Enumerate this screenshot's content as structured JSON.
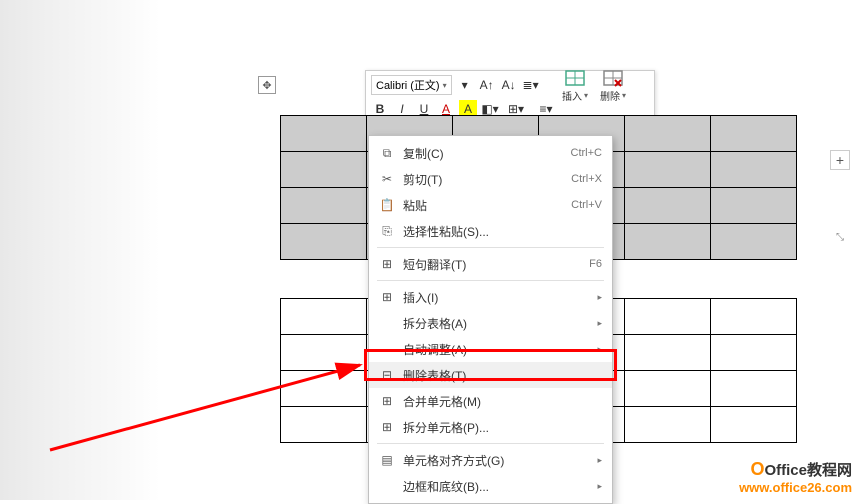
{
  "toolbar": {
    "font_name": "Calibri (正文)",
    "insert_label": "插入",
    "delete_label": "删除",
    "bold": "B",
    "italic": "I",
    "underline": "U",
    "font_color": "A",
    "highlight": "A"
  },
  "move_handle": "✥",
  "context_menu": {
    "items": [
      {
        "icon": "⧉",
        "label": "复制(C)",
        "shortcut": "Ctrl+C"
      },
      {
        "icon": "✂",
        "label": "剪切(T)",
        "shortcut": "Ctrl+X"
      },
      {
        "icon": "📋",
        "label": "粘贴",
        "shortcut": "Ctrl+V"
      },
      {
        "icon": "⎘",
        "label": "选择性粘贴(S)...",
        "shortcut": ""
      },
      {
        "icon": "⊞",
        "label": "短句翻译(T)",
        "shortcut": "F6"
      },
      {
        "icon": "⊞",
        "label": "插入(I)",
        "submenu": true
      },
      {
        "icon": "",
        "label": "拆分表格(A)",
        "submenu": true
      },
      {
        "icon": "",
        "label": "自动调整(A)",
        "submenu": true
      },
      {
        "icon": "⊟",
        "label": "删除表格(T)",
        "highlight": true
      },
      {
        "icon": "⊞",
        "label": "合并单元格(M)"
      },
      {
        "icon": "⊞",
        "label": "拆分单元格(P)..."
      },
      {
        "icon": "▤",
        "label": "单元格对齐方式(G)",
        "submenu": true
      },
      {
        "icon": "",
        "label": "边框和底纹(B)...",
        "submenu": true
      }
    ]
  },
  "side": {
    "plus": "+"
  },
  "watermark": {
    "logo_char": "O",
    "brand": "Office",
    "cn": "教程网",
    "url": "www.office26.com"
  }
}
